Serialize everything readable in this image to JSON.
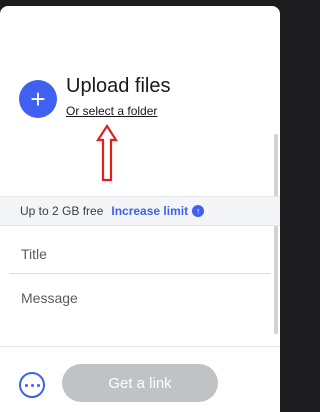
{
  "upload": {
    "title": "Upload files",
    "select_folder": "Or select a folder",
    "plus_symbol": "+"
  },
  "limit": {
    "text": "Up to 2 GB free",
    "link": "Increase limit",
    "icon": "arrow-up-circle-icon"
  },
  "form": {
    "title_placeholder": "Title",
    "message_placeholder": "Message"
  },
  "footer": {
    "more_icon": "more-options-icon",
    "get_link_label": "Get a link"
  },
  "colors": {
    "accent": "#4060f0",
    "button_disabled": "#c0c2c6",
    "annotation": "#e02020",
    "backdrop": "#1c1c1e"
  }
}
